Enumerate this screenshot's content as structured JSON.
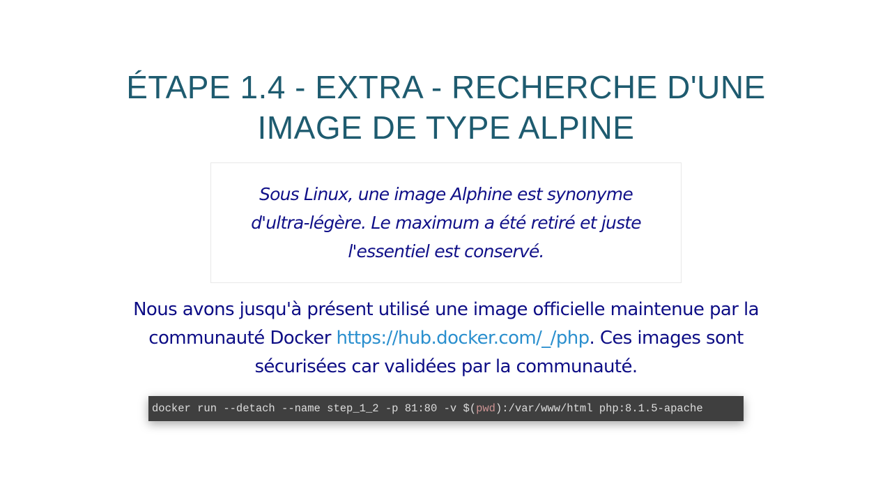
{
  "slide": {
    "title": "ÉTAPE 1.4 - EXTRA - RECHERCHE D'UNE IMAGE DE TYPE ALPINE",
    "quote": "Sous Linux, une image Alphine est synonyme d'ultra-légère. Le maximum a été retiré et juste l'essentiel est conservé.",
    "body": {
      "before_link": "Nous avons jusqu'à présent utilisé une image officielle maintenue par la communauté Docker ",
      "link_text": "https://hub.docker.com/_/php",
      "link_href": "https://hub.docker.com/_/php",
      "after_link": ". Ces images sont sécurisées car validées par la communauté."
    },
    "code": {
      "part1": "docker run --detach --name step_1_2 -p 81:80 -v $(",
      "highlight": "pwd",
      "part2": "):/var/www/html php:8.1.5-apache"
    },
    "colors": {
      "title": "#1e5b6f",
      "text": "#0d0d85",
      "link": "#2a8fce",
      "code_bg": "#3f3f3f",
      "code_text": "#dcdcdc",
      "code_highlight": "#cc9393"
    }
  }
}
